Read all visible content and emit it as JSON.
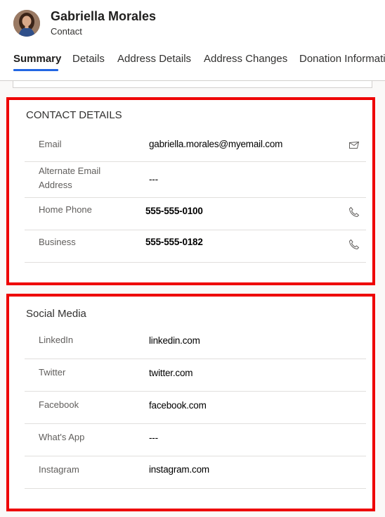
{
  "header": {
    "name": "Gabriella Morales",
    "entity_type": "Contact"
  },
  "tabs": [
    {
      "label": "Summary",
      "active": true
    },
    {
      "label": "Details",
      "active": false
    },
    {
      "label": "Address Details",
      "active": false
    },
    {
      "label": "Address Changes",
      "active": false
    },
    {
      "label": "Donation Information",
      "active": false
    }
  ],
  "contact_details": {
    "title": "CONTACT DETAILS",
    "rows": [
      {
        "label": "Email",
        "value": "gabriella.morales@myemail.com",
        "icon": "email-icon"
      },
      {
        "label": "Alternate Email Address",
        "value": "---"
      },
      {
        "label": "Home Phone",
        "value": "555-555-0100",
        "icon": "phone-icon"
      },
      {
        "label": "Business",
        "value": "555-555-0182",
        "icon": "phone-icon"
      }
    ]
  },
  "social_media": {
    "title": "Social Media",
    "rows": [
      {
        "label": "LinkedIn",
        "value": "linkedin.com"
      },
      {
        "label": "Twitter",
        "value": "twitter.com"
      },
      {
        "label": "Facebook",
        "value": "facebook.com"
      },
      {
        "label": "What's App",
        "value": "---"
      },
      {
        "label": "Instagram",
        "value": "instagram.com"
      }
    ]
  },
  "colors": {
    "accent": "#2266e3",
    "highlight": "#ee0000",
    "label": "#605e5c",
    "divider": "#e1dfdd"
  }
}
